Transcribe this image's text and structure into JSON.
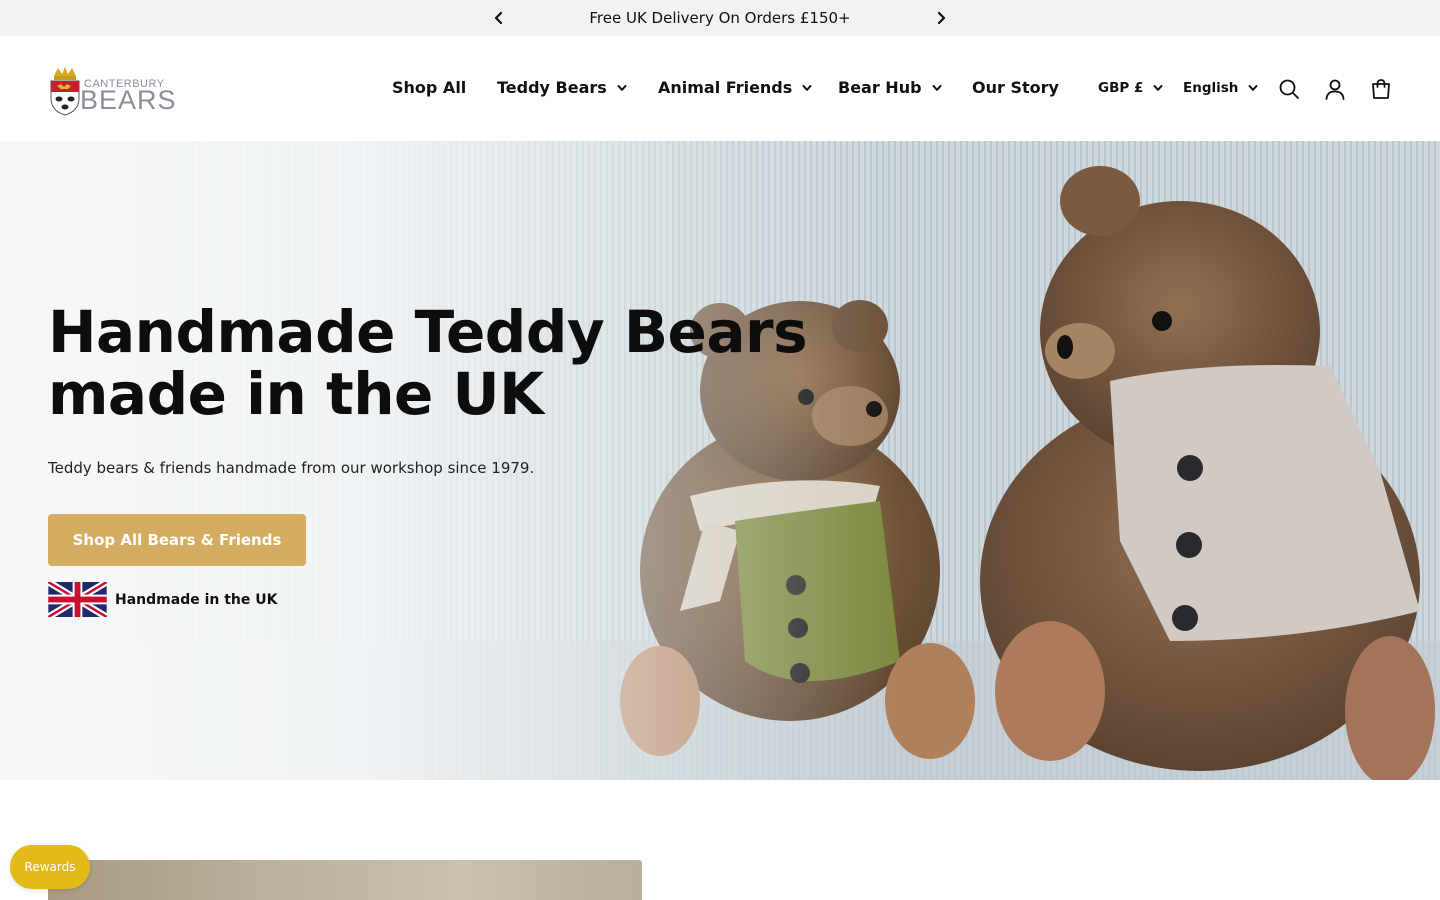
{
  "announcement": {
    "message": "Free UK Delivery On Orders £150+",
    "prev_icon": "chevron-left-icon",
    "next_icon": "chevron-right-icon"
  },
  "header": {
    "logo": {
      "word_top": "CANTERBURY",
      "word_main": "BEARS"
    },
    "nav": [
      {
        "label": "Shop All",
        "has_dropdown": false
      },
      {
        "label": "Teddy Bears",
        "has_dropdown": true
      },
      {
        "label": "Animal Friends",
        "has_dropdown": true
      },
      {
        "label": "Bear Hub",
        "has_dropdown": true
      },
      {
        "label": "Our Story",
        "has_dropdown": false
      }
    ],
    "currency": "GBP £",
    "language": "English",
    "icons": [
      "search-icon",
      "account-icon",
      "cart-icon"
    ]
  },
  "hero": {
    "title": "Handmade Teddy Bears made in the UK",
    "subtitle": "Teddy bears & friends handmade from our workshop since 1979.",
    "cta_label": "Shop All Bears & Friends",
    "badge_label": "Handmade in the UK"
  },
  "rewards": {
    "label": "Rewards"
  },
  "colors": {
    "announcement_bg": "#f2f2f2",
    "cta": "#d4ad62",
    "rewards": "#e4b91a",
    "text": "#111111"
  }
}
